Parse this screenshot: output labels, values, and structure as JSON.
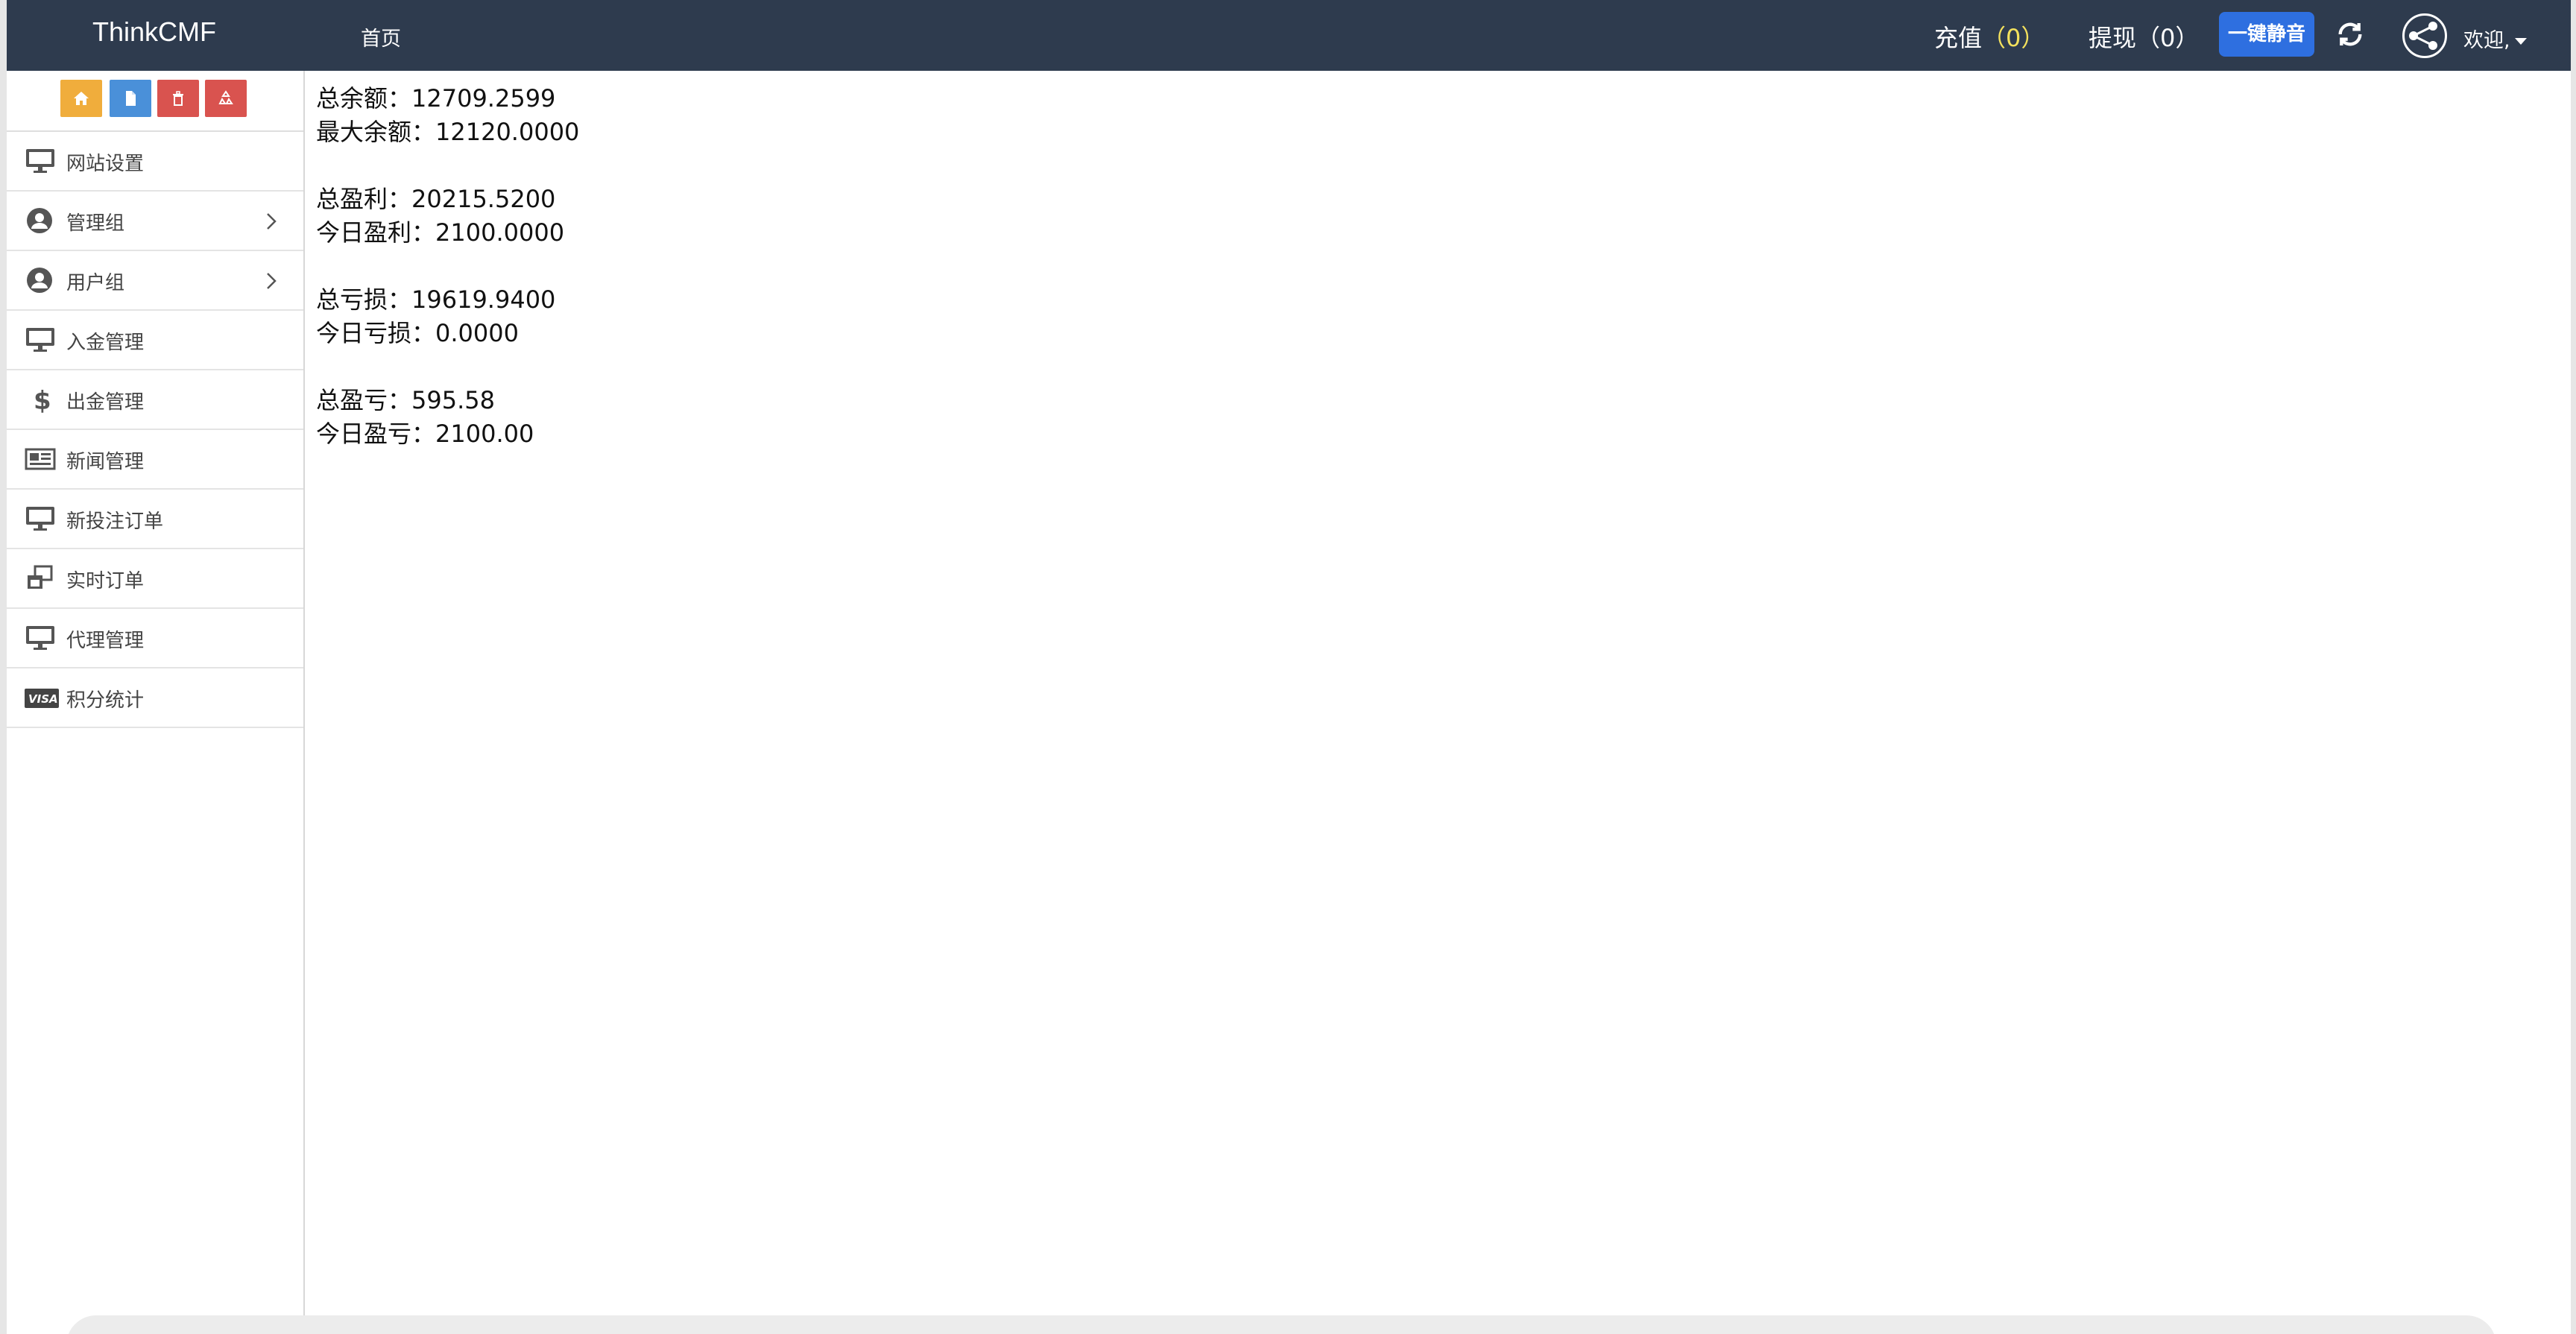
{
  "header": {
    "brand": "ThinkCMF",
    "home": "首页",
    "recharge_label": "充值",
    "recharge_count": "（0）",
    "withdraw_label": "提现",
    "withdraw_count": "（0）",
    "mute_button": "一键静音",
    "welcome": "欢迎,"
  },
  "sidebar": {
    "quick_buttons": [
      {
        "name": "home",
        "color": "#f0ad3c",
        "icon": "home-icon"
      },
      {
        "name": "file",
        "color": "#4a90d9",
        "icon": "file-icon"
      },
      {
        "name": "trash",
        "color": "#d9534f",
        "icon": "trash-icon"
      },
      {
        "name": "recycle",
        "color": "#d9534f",
        "icon": "recycle-icon"
      }
    ],
    "items": [
      {
        "label": "网站设置",
        "icon": "monitor-icon",
        "chevron": false
      },
      {
        "label": "管理组",
        "icon": "user-circle-icon",
        "chevron": true
      },
      {
        "label": "用户组",
        "icon": "user-circle-icon",
        "chevron": true
      },
      {
        "label": "入金管理",
        "icon": "monitor-icon",
        "chevron": false
      },
      {
        "label": "出金管理",
        "icon": "dollar-icon",
        "chevron": false
      },
      {
        "label": "新闻管理",
        "icon": "newspaper-icon",
        "chevron": false
      },
      {
        "label": "新投注订单",
        "icon": "monitor-icon",
        "chevron": false
      },
      {
        "label": "实时订单",
        "icon": "windows-restore-icon",
        "chevron": false
      },
      {
        "label": "代理管理",
        "icon": "monitor-icon",
        "chevron": false
      },
      {
        "label": "积分统计",
        "icon": "visa-card-icon",
        "chevron": false
      }
    ]
  },
  "stats": {
    "total_balance": "总余额：12709.2599",
    "max_balance": "最大余额：12120.0000",
    "total_profit": "总盈利：20215.5200",
    "today_profit": "今日盈利：2100.0000",
    "total_loss": "总亏损：19619.9400",
    "today_loss": "今日亏损：0.0000",
    "total_pnl": "总盈亏：595.58",
    "today_pnl": "今日盈亏：2100.00"
  }
}
